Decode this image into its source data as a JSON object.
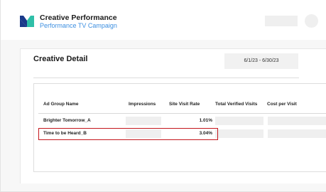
{
  "header": {
    "brand_title": "Creative Performance",
    "brand_subtitle": "Performance TV Campaign",
    "logo_colors": [
      "#1a3a8a",
      "#2fbfa8"
    ],
    "subtitle_color": "#3d8fe0"
  },
  "card": {
    "title": "Creative Detail",
    "date_range": "6/1/23 - 6/30/23"
  },
  "table": {
    "columns": [
      "Ad Group Name",
      "Impressions",
      "Site Visit Rate",
      "Total Verified Visits",
      "Cost per Visit"
    ],
    "rows": [
      {
        "ad_group": "Brighter Tomorrow_A",
        "site_visit_rate": "1.01%",
        "selected": false
      },
      {
        "ad_group": "Time to be Heard_B",
        "site_visit_rate": "3.04%",
        "selected": true
      }
    ],
    "highlight_color": "#c4161c"
  }
}
